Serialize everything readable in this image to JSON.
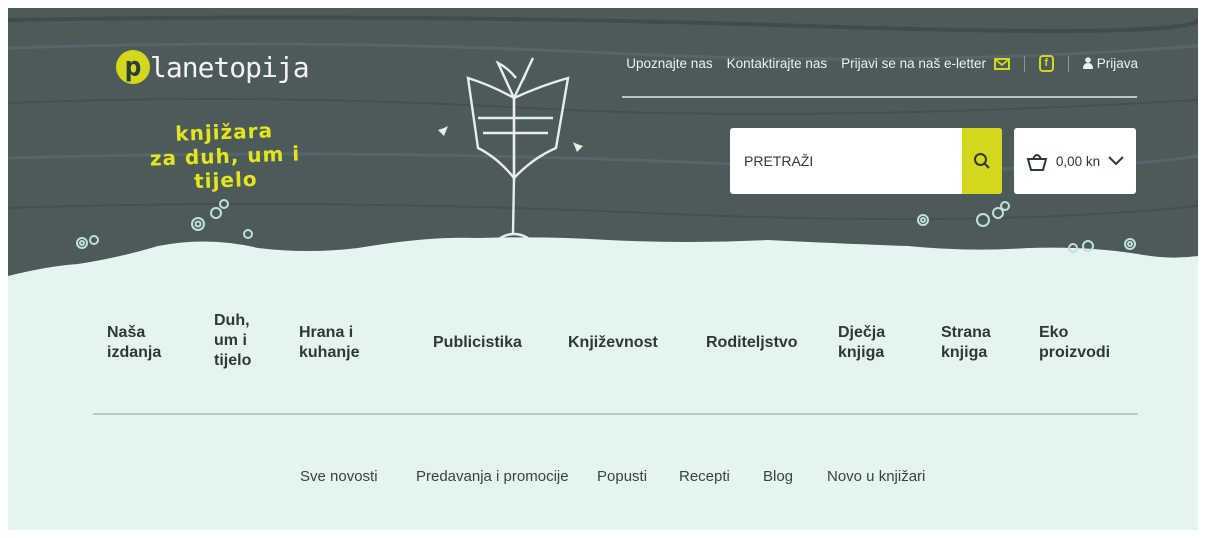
{
  "brand": {
    "logo_letter": "p",
    "logo_rest": "lanetopija",
    "tagline_line1": "knjižara",
    "tagline_line2": "za duh, um i tijelo"
  },
  "topnav": {
    "about": "Upoznajte nas",
    "contact": "Kontaktirajte nas",
    "newsletter": "Prijavi se na naš e-letter",
    "login": "Prijava"
  },
  "search": {
    "placeholder": "PRETRAŽI"
  },
  "cart": {
    "total": "0,00 kn"
  },
  "mainnav": [
    {
      "label": "Naša izdanja"
    },
    {
      "label": "Duh, um i tijelo"
    },
    {
      "label": "Hrana i kuhanje"
    },
    {
      "label": "Publicistika"
    },
    {
      "label": "Književnost"
    },
    {
      "label": "Roditeljstvo"
    },
    {
      "label": "Dječja knjiga"
    },
    {
      "label": "Strana knjiga"
    },
    {
      "label": "Eko proizvodi"
    }
  ],
  "subnav": [
    {
      "label": "Sve novosti"
    },
    {
      "label": "Predavanja i promocije"
    },
    {
      "label": "Popusti"
    },
    {
      "label": "Recepti"
    },
    {
      "label": "Blog"
    },
    {
      "label": "Novo u knjižari"
    }
  ],
  "colors": {
    "accent": "#d3d81c",
    "header_bg": "#4a5757",
    "page_bg": "#e4f4ef",
    "nav_text": "#2f3838"
  },
  "icons": [
    "envelope-icon",
    "facebook-icon",
    "user-icon",
    "search-icon",
    "basket-icon",
    "chevron-down-icon",
    "book-tree-illustration",
    "spiral-decoration"
  ]
}
